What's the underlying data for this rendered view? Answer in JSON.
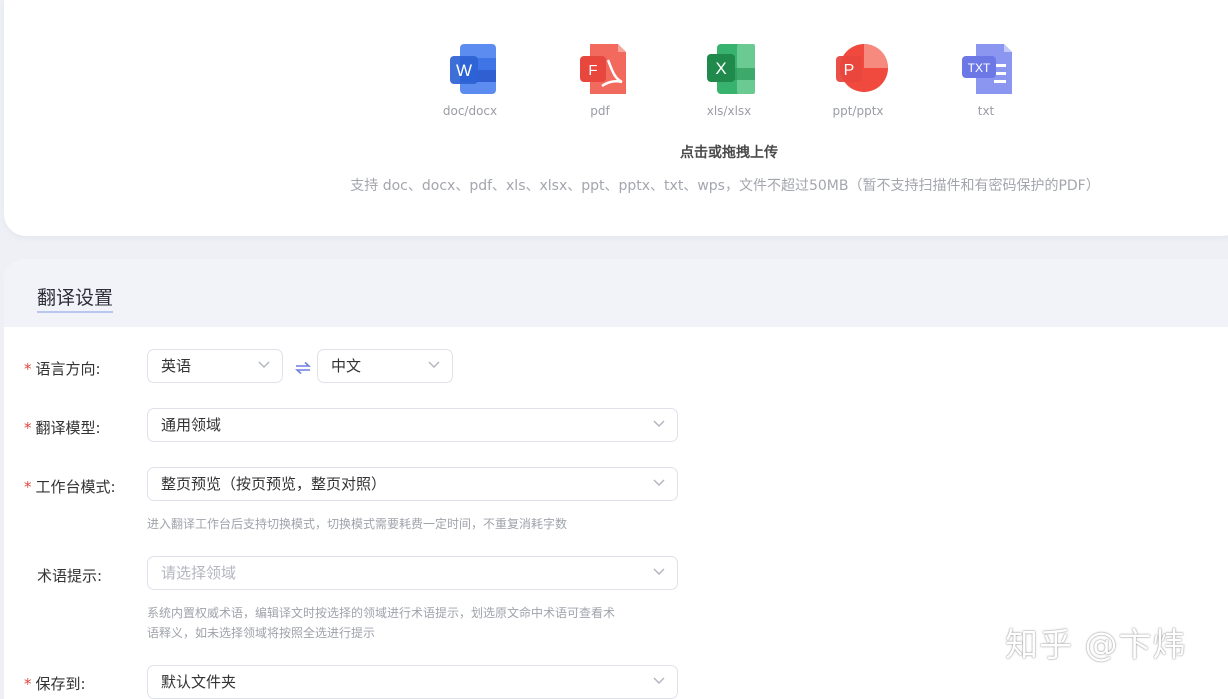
{
  "upload": {
    "file_types": [
      {
        "label": "doc/docx",
        "icon": "word-doc-icon",
        "glyph": "W",
        "color": "#3f74e6"
      },
      {
        "label": "pdf",
        "icon": "pdf-icon",
        "glyph": "F",
        "color": "#e8473e"
      },
      {
        "label": "xls/xlsx",
        "icon": "excel-icon",
        "glyph": "X",
        "color": "#2aa562"
      },
      {
        "label": "ppt/pptx",
        "icon": "powerpoint-icon",
        "glyph": "P",
        "color": "#f05a4a"
      },
      {
        "label": "txt",
        "icon": "txt-file-icon",
        "glyph": "TXT",
        "color": "#6b78e6"
      }
    ],
    "title": "点击或拖拽上传",
    "hint": "支持 doc、docx、pdf、xls、xlsx、ppt、pptx、txt、wps，文件不超过50MB（暂不支持扫描件和有密码保护的PDF）"
  },
  "settings": {
    "title": "翻译设置",
    "language": {
      "label": "语言方向:",
      "source": "英语",
      "target": "中文",
      "swap_icon": "swap-arrows-icon"
    },
    "model": {
      "label": "翻译模型:",
      "value": "通用领域"
    },
    "workspace": {
      "label": "工作台模式:",
      "value": "整页预览（按页预览，整页对照）",
      "help": "进入翻译工作台后支持切换模式，切换模式需要耗费一定时间，不重复消耗字数"
    },
    "terms": {
      "label": "术语提示:",
      "placeholder": "请选择领域",
      "help_line1": "系统内置权威术语，编辑译文时按选择的领域进行术语提示，划选原文命中术语可查看术",
      "help_line2": "语释义，如未选择领域将按照全选进行提示"
    },
    "save": {
      "label": "保存到:",
      "value": "默认文件夹"
    },
    "required_mark": "*"
  },
  "watermark": "知乎 @卞炜",
  "colors": {
    "accent": "#6b7fe0",
    "required": "#e0463f"
  }
}
